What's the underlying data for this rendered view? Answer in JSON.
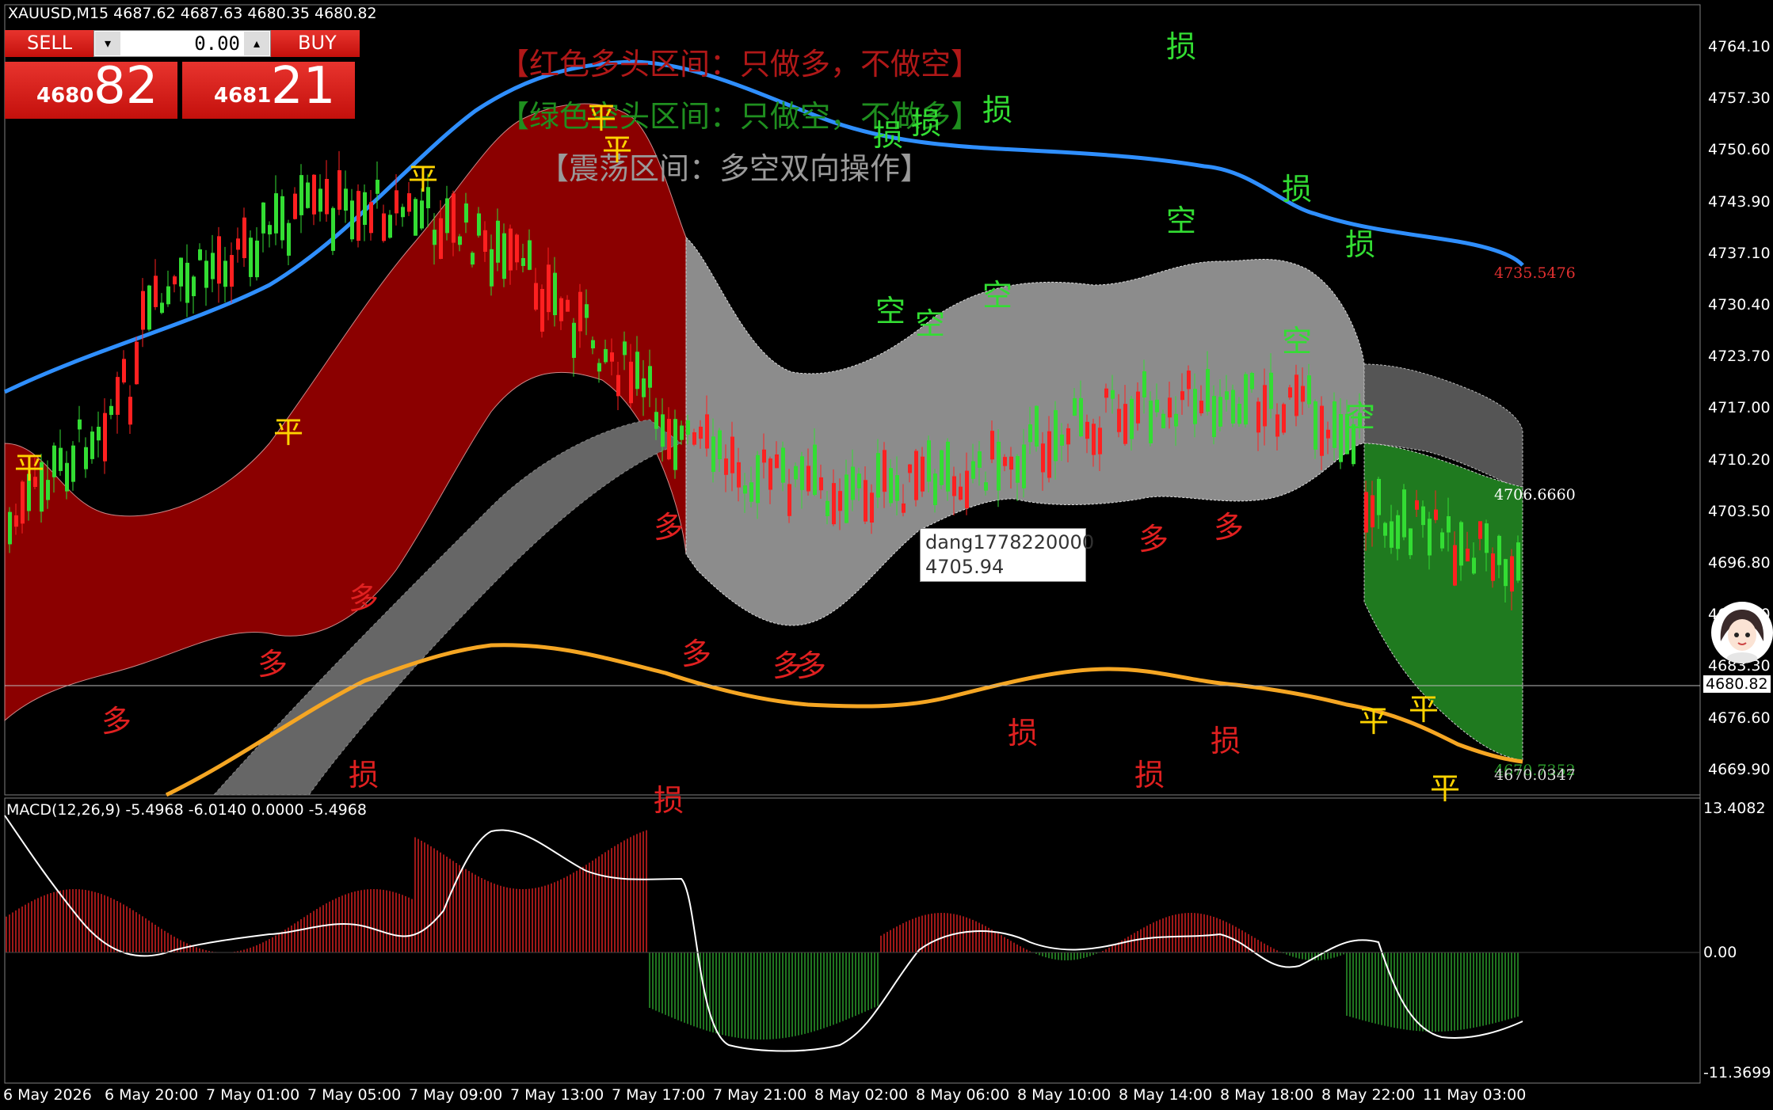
{
  "header": {
    "symbol_line": "XAUUSD,M15  4687.62 4687.63 4680.35 4680.82",
    "macd_line": "MACD(12,26,9) -5.4968 -6.0140 0.0000 -5.4968"
  },
  "trade_panel": {
    "sell_label": "SELL",
    "buy_label": "BUY",
    "lot_value": "0.00",
    "sell_price_prefix": "4680",
    "sell_price_big": "82",
    "buy_price_prefix": "4681",
    "buy_price_big": "21"
  },
  "legend": {
    "red_zone": "【红色多头区间：只做多，不做空】",
    "green_zone": "【绿色空头区间：只做空，不做多】",
    "range_zone": "【震荡区间：多空双向操作】"
  },
  "tooltip": {
    "name": "dang1778220000",
    "value": "4705.94"
  },
  "price_axis": [
    "4764.10",
    "4757.30",
    "4750.60",
    "4743.90",
    "4737.10",
    "4730.40",
    "4723.70",
    "4717.00",
    "4710.20",
    "4703.50",
    "4696.80",
    "4690.10",
    "4683.30",
    "4676.60",
    "4669.90"
  ],
  "current_price": "4680.82",
  "band_labels": {
    "upper_ma": "4735.5476",
    "band_mid": "4706.6660",
    "lower_a": "4670.7352",
    "lower_b": "4670.0347"
  },
  "macd_axis": {
    "top": "13.4082",
    "zero": "0.00",
    "bottom": "-11.3699"
  },
  "time_axis": [
    "6 May 2026",
    "6 May 20:00",
    "7 May 01:00",
    "7 May 05:00",
    "7 May 09:00",
    "7 May 13:00",
    "7 May 17:00",
    "7 May 21:00",
    "8 May 02:00",
    "8 May 06:00",
    "8 May 10:00",
    "8 May 14:00",
    "8 May 18:00",
    "8 May 22:00",
    "11 May 03:00"
  ],
  "signals": {
    "long": "多",
    "short": "空",
    "close": "平",
    "stop": "损"
  },
  "colors": {
    "background": "#000000",
    "bull_band": "#8b0000",
    "bear_band": "#1f7a1f",
    "range_band": "#8a8a8a",
    "upper_ma": "#2f8fff",
    "lower_ma": "#f5a623",
    "candle_up": "#ff2020",
    "candle_down": "#33dd33"
  },
  "chart_data": {
    "type": "line",
    "title": "",
    "xlabel": "",
    "ylabel": "",
    "ylim": [
      4666.5,
      4767.5
    ],
    "categories": [
      "6 May 2026",
      "6 May 20:00",
      "7 May 01:00",
      "7 May 05:00",
      "7 May 09:00",
      "7 May 13:00",
      "7 May 17:00",
      "7 May 21:00",
      "8 May 02:00",
      "8 May 06:00",
      "8 May 10:00",
      "8 May 14:00",
      "8 May 18:00",
      "8 May 22:00",
      "11 May 03:00"
    ],
    "series": [
      {
        "name": "",
        "values": [
          4717,
          4721,
          4727,
          4734,
          4744,
          4752,
          4756,
          4753,
          4751,
          4750,
          4749,
          4748,
          4744,
          4740,
          4736
        ]
      },
      {
        "name": "",
        "values": [
          4662,
          4668,
          4676,
          4684,
          4688,
          4688,
          4686,
          4683,
          4682,
          4683,
          4685,
          4684,
          4682,
          4679,
          4671
        ]
      }
    ]
  }
}
